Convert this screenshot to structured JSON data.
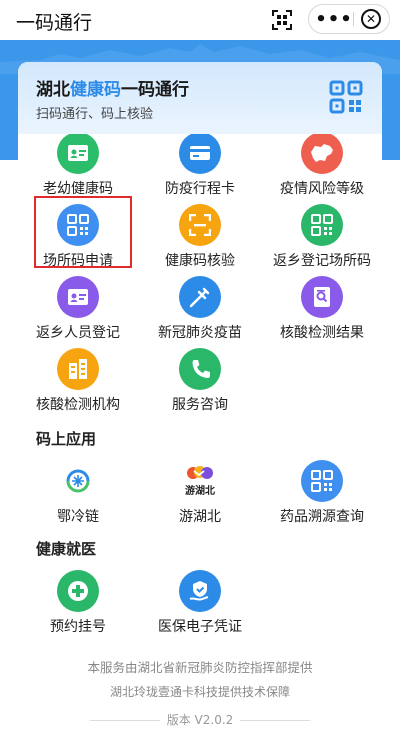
{
  "topbar": {
    "title": "一码通行"
  },
  "header": {
    "title_part1": "湖北",
    "title_highlight": "健康码",
    "title_part2": "一码通行",
    "subtitle": "扫码通行、码上核验"
  },
  "grid_items": [
    {
      "label": "老幼健康码",
      "icon": "id-card-icon",
      "color": "#2bbd6a"
    },
    {
      "label": "防疫行程卡",
      "icon": "card-icon",
      "color": "#2d8be8"
    },
    {
      "label": "疫情风险等级",
      "icon": "china-map-icon",
      "color": "#ee5f50"
    },
    {
      "label": "场所码申请",
      "icon": "qr-code-icon",
      "color": "#3f8ff0"
    },
    {
      "label": "健康码核验",
      "icon": "scan-frame-icon",
      "color": "#f6a40f"
    },
    {
      "label": "返乡登记场所码",
      "icon": "qr-code-icon",
      "color": "#2bb769"
    },
    {
      "label": "返乡人员登记",
      "icon": "id-card-icon",
      "color": "#8a5bea"
    },
    {
      "label": "新冠肺炎疫苗",
      "icon": "syringe-icon",
      "color": "#2d8be8"
    },
    {
      "label": "核酸检测结果",
      "icon": "report-icon",
      "color": "#8a5bea"
    },
    {
      "label": "核酸检测机构",
      "icon": "building-icon",
      "color": "#f6a40f"
    },
    {
      "label": "服务咨询",
      "icon": "phone-icon",
      "color": "#2bb769"
    }
  ],
  "sections": {
    "apps_title": "码上应用",
    "apps": [
      {
        "label": "鄂冷链",
        "icon": "cold-chain-logo-icon"
      },
      {
        "label": "游湖北",
        "icon": "tour-hubei-logo-icon",
        "logo_text": "游湖北"
      },
      {
        "label": "药品溯源查询",
        "icon": "qr-code-icon",
        "color": "#3f8ff0"
      }
    ],
    "medical_title": "健康就医",
    "medical": [
      {
        "label": "预约挂号",
        "icon": "plus-cross-icon",
        "color": "#2bb769"
      },
      {
        "label": "医保电子凭证",
        "icon": "insurance-hand-icon",
        "color": "#2d8be8"
      }
    ]
  },
  "footer": {
    "line1": "本服务由湖北省新冠肺炎防控指挥部提供",
    "line2": "湖北玲珑壹通卡科技提供技术保障",
    "version": "版本 V2.0.2"
  }
}
